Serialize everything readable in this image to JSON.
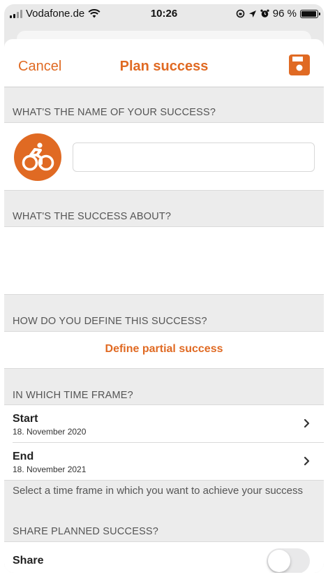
{
  "status_bar": {
    "carrier": "Vodafone.de",
    "time": "10:26",
    "battery": "96 %",
    "battery_level": 0.96,
    "signal_bars_active": 2,
    "signal_bars_total": 4
  },
  "nav": {
    "cancel_label": "Cancel",
    "title": "Plan success",
    "save_icon": "floppy-disk-icon"
  },
  "sections": {
    "name_header": "WHAT'S THE NAME OF YOUR SUCCESS?",
    "about_header": "WHAT'S THE SUCCESS ABOUT?",
    "define_header": "HOW DO YOU DEFINE THIS SUCCESS?",
    "timeframe_header": "IN WHICH TIME FRAME?",
    "share_header": "SHARE PLANNED SUCCESS?"
  },
  "name": {
    "icon": "cyclist-icon",
    "value": "",
    "placeholder": ""
  },
  "about": {
    "value": ""
  },
  "define": {
    "link_label": "Define partial success"
  },
  "timeframe": {
    "start": {
      "label": "Start",
      "value": "18. November 2020"
    },
    "end": {
      "label": "End",
      "value": "18. November 2021"
    },
    "hint": "Select a time frame in which you want to achieve your success"
  },
  "share": {
    "label": "Share",
    "enabled": false
  },
  "colors": {
    "accent": "#e06a23",
    "background": "#ececec",
    "text": "#222222"
  }
}
